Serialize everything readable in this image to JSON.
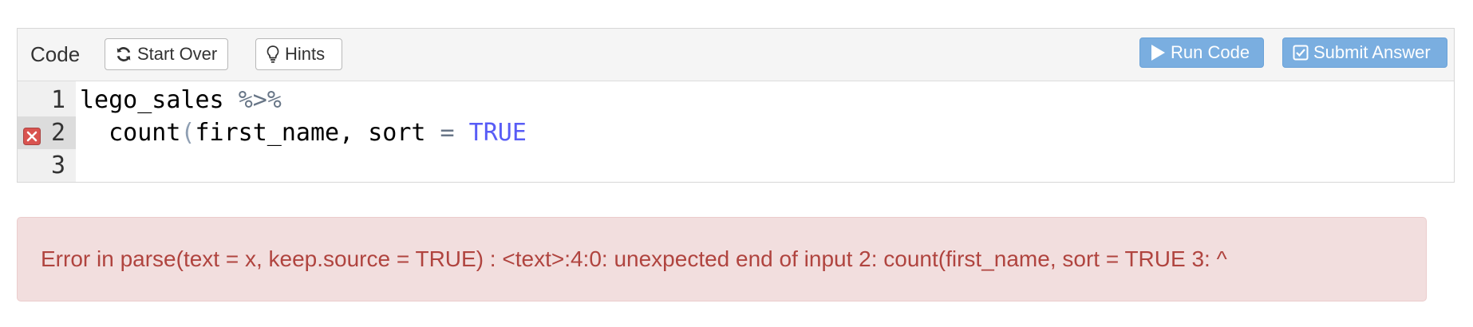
{
  "toolbar": {
    "title": "Code",
    "start_over_label": "Start Over",
    "hints_label": "Hints",
    "run_code_label": "Run Code",
    "submit_answer_label": "Submit Answer"
  },
  "editor": {
    "lines": [
      {
        "number": "1",
        "tokens": [
          {
            "text": "lego_sales ",
            "type": "plain"
          },
          {
            "text": "%>%",
            "type": "operator"
          }
        ]
      },
      {
        "number": "2",
        "has_error": true,
        "tokens": [
          {
            "text": "  count",
            "type": "plain"
          },
          {
            "text": "(",
            "type": "paren"
          },
          {
            "text": "first_name, sort ",
            "type": "plain"
          },
          {
            "text": "=",
            "type": "operator"
          },
          {
            "text": " ",
            "type": "plain"
          },
          {
            "text": "TRUE",
            "type": "boolean"
          }
        ]
      },
      {
        "number": "3",
        "tokens": []
      }
    ]
  },
  "error": {
    "message": "Error in parse(text = x, keep.source = TRUE) : <text>:4:0: unexpected end of input 2: count(first_name, sort = TRUE 3: ^"
  },
  "colors": {
    "primary_button": "#7aaee0",
    "error_background": "#f2dede",
    "error_text": "#b0443f",
    "error_marker": "#d9534f",
    "boolean_token": "#585cf6"
  },
  "icons": {
    "start_over": "refresh-icon",
    "hints": "lightbulb-icon",
    "run_code": "play-icon",
    "submit_answer": "checkbox-icon",
    "line_error": "error-x-icon"
  }
}
